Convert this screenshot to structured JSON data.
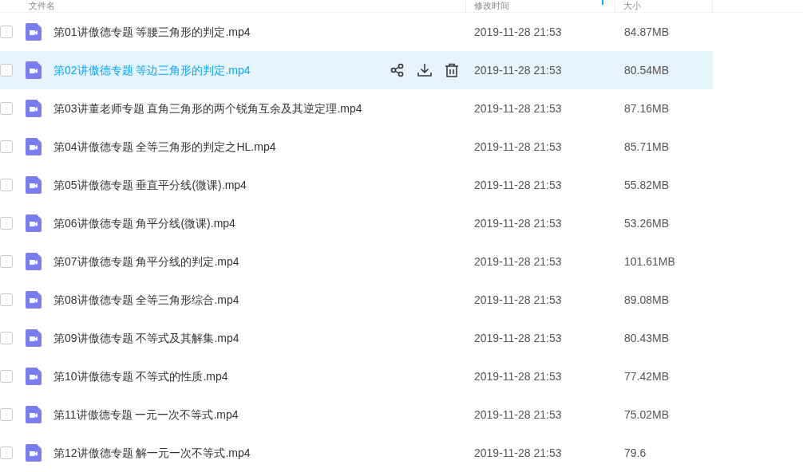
{
  "columns": [
    {
      "label": "文件名",
      "sorted": false
    },
    {
      "label": "修改时间",
      "sorted": true
    },
    {
      "label": "大小",
      "sorted": false
    }
  ],
  "files": [
    {
      "name": "第01讲傲德专题 等腰三角形的判定.mp4",
      "modified": "2019-11-28 21:53",
      "size": "84.87MB",
      "selected": false,
      "checked": false
    },
    {
      "name": "第02讲傲德专题 等边三角形的判定.mp4",
      "modified": "2019-11-28 21:53",
      "size": "80.54MB",
      "selected": true,
      "checked": false
    },
    {
      "name": "第03讲董老师专题 直角三角形的两个锐角互余及其逆定理.mp4",
      "modified": "2019-11-28 21:53",
      "size": "87.16MB",
      "selected": false,
      "checked": false
    },
    {
      "name": "第04讲傲德专题 全等三角形的判定之HL.mp4",
      "modified": "2019-11-28 21:53",
      "size": "85.71MB",
      "selected": false,
      "checked": false
    },
    {
      "name": "第05讲傲德专题 垂直平分线(微课).mp4",
      "modified": "2019-11-28 21:53",
      "size": "55.82MB",
      "selected": false,
      "checked": false
    },
    {
      "name": "第06讲傲德专题 角平分线(微课).mp4",
      "modified": "2019-11-28 21:53",
      "size": "53.26MB",
      "selected": false,
      "checked": false
    },
    {
      "name": "第07讲傲德专题 角平分线的判定.mp4",
      "modified": "2019-11-28 21:53",
      "size": "101.61MB",
      "selected": false,
      "checked": false
    },
    {
      "name": "第08讲傲德专题 全等三角形综合.mp4",
      "modified": "2019-11-28 21:53",
      "size": "89.08MB",
      "selected": false,
      "checked": false
    },
    {
      "name": "第09讲傲德专题 不等式及其解集.mp4",
      "modified": "2019-11-28 21:53",
      "size": "80.43MB",
      "selected": false,
      "checked": false
    },
    {
      "name": "第10讲傲德专题 不等式的性质.mp4",
      "modified": "2019-11-28 21:53",
      "size": "77.42MB",
      "selected": false,
      "checked": false
    },
    {
      "name": "第11讲傲德专题 一元一次不等式.mp4",
      "modified": "2019-11-28 21:53",
      "size": "75.02MB",
      "selected": false,
      "checked": false
    },
    {
      "name": "第12讲傲德专题 解一元一次不等式.mp4",
      "modified": "2019-11-28 21:53",
      "size": "79.6",
      "selected": false,
      "checked": false
    }
  ]
}
